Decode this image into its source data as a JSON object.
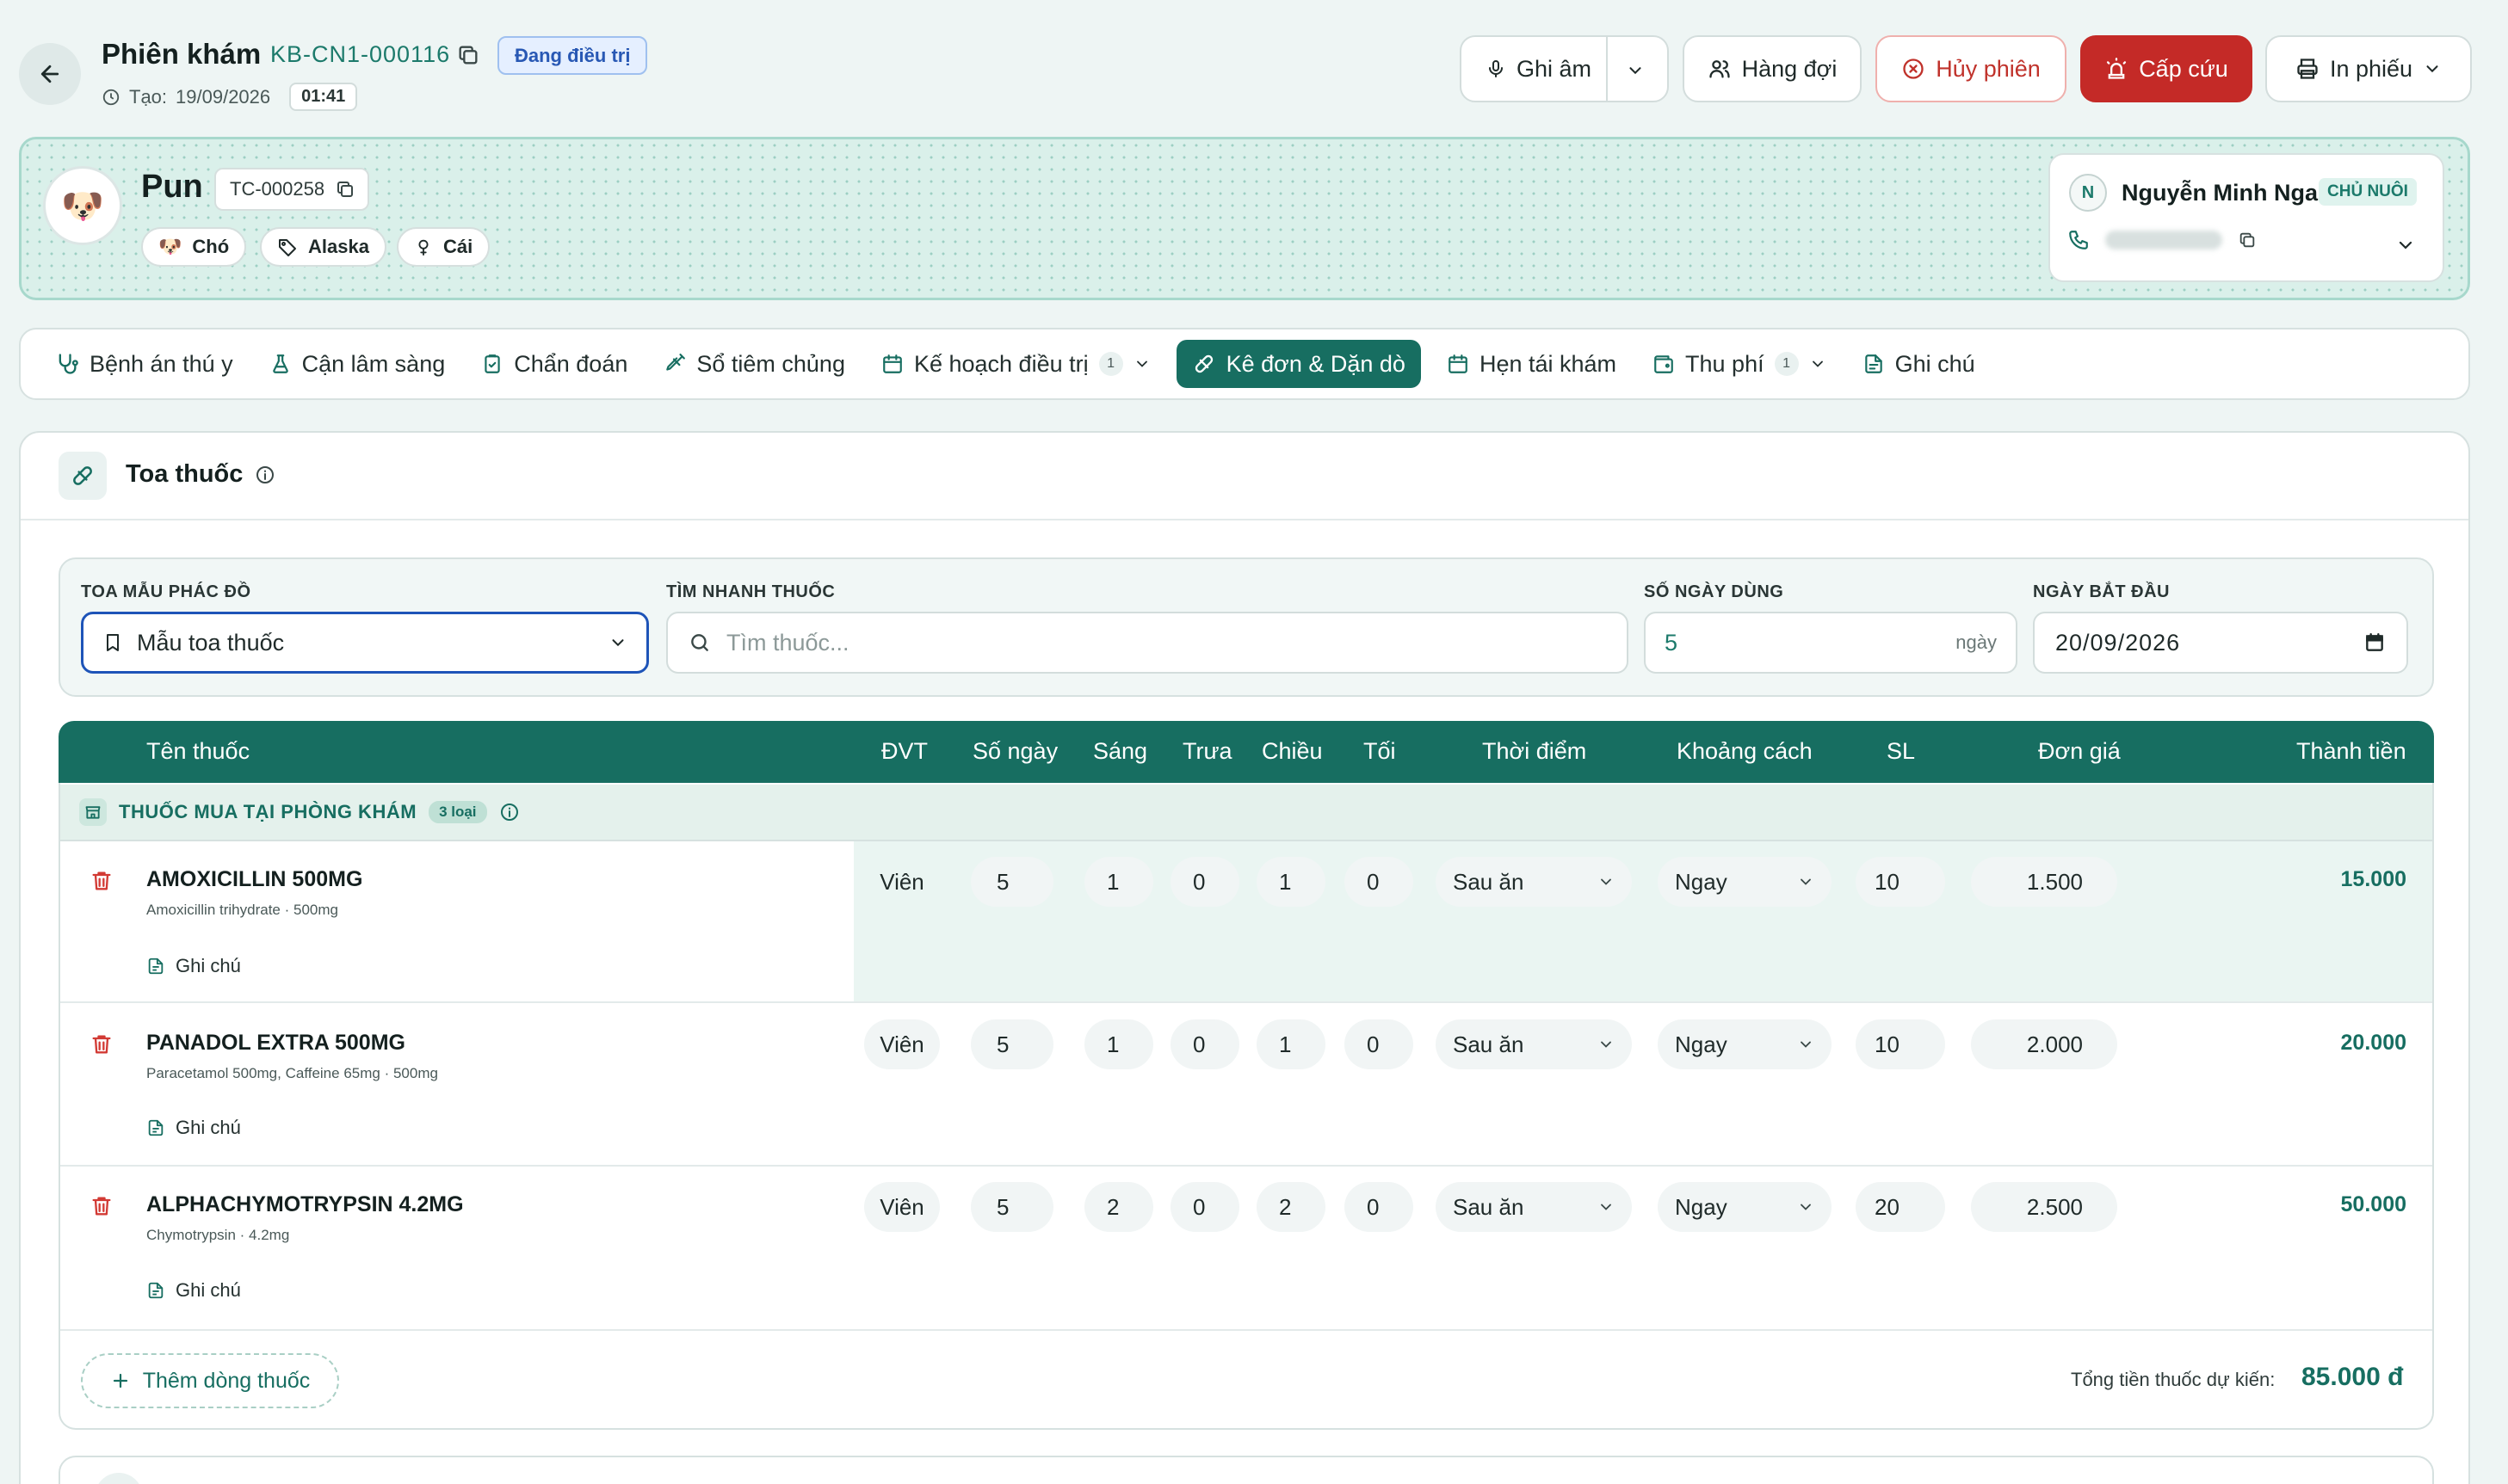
{
  "header": {
    "title": "Phiên khám",
    "code": "KB-CN1-000116",
    "status": "Đang điều trị",
    "created_label": "Tạo:",
    "created_date": "19/09/2026",
    "created_time": "01:41",
    "buttons": {
      "record": "Ghi âm",
      "queue": "Hàng đợi",
      "cancel": "Hủy phiên",
      "emergency": "Cấp cứu",
      "print": "In phiếu"
    }
  },
  "patient": {
    "name": "Pun",
    "code": "TC-000258",
    "species": "Chó",
    "breed": "Alaska",
    "sex": "Cái",
    "owner": {
      "initial": "N",
      "name": "Nguyễn Minh Nga",
      "role": "CHỦ NUÔI"
    }
  },
  "tabs": [
    {
      "label": "Bệnh án thú y",
      "icon": "stethoscope-icon"
    },
    {
      "label": "Cận lâm sàng",
      "icon": "flask-icon"
    },
    {
      "label": "Chẩn đoán",
      "icon": "clipboard-icon"
    },
    {
      "label": "Sổ tiêm chủng",
      "icon": "syringe-icon"
    },
    {
      "label": "Kế hoạch điều trị",
      "icon": "calendar-icon",
      "count": "1"
    },
    {
      "label": "Kê đơn & Dặn dò",
      "icon": "pill-icon",
      "active": true
    },
    {
      "label": "Hẹn tái khám",
      "icon": "calendar-icon"
    },
    {
      "label": "Thu phí",
      "icon": "wallet-icon",
      "count": "1"
    },
    {
      "label": "Ghi chú",
      "icon": "note-icon"
    }
  ],
  "prescription": {
    "title": "Toa thuốc",
    "filters": {
      "template_label": "TOA MẪU PHÁC ĐỒ",
      "template_value": "Mẫu toa thuốc",
      "search_label": "TÌM NHANH THUỐC",
      "search_placeholder": "Tìm thuốc...",
      "days_label": "SỐ NGÀY DÙNG",
      "days_value": "5",
      "days_suffix": "ngày",
      "start_label": "NGÀY BẮT ĐẦU",
      "start_value": "20/09/2026"
    },
    "columns": {
      "name": "Tên thuốc",
      "unit": "ĐVT",
      "days": "Số ngày",
      "morning": "Sáng",
      "noon": "Trưa",
      "afternoon": "Chiều",
      "night": "Tối",
      "timing": "Thời điểm",
      "interval": "Khoảng cách",
      "qty": "SL",
      "price": "Đơn giá",
      "total": "Thành tiền"
    },
    "group": {
      "label": "THUỐC MUA TẠI PHÒNG KHÁM",
      "count": "3 loại"
    },
    "rows": [
      {
        "name": "AMOXICILLIN 500MG",
        "sub": "Amoxicillin trihydrate · 500mg",
        "note": "Ghi chú",
        "unit": "Viên",
        "days": "5",
        "morning": "1",
        "noon": "0",
        "afternoon": "1",
        "night": "0",
        "timing": "Sau ăn",
        "interval": "Ngay",
        "qty": "10",
        "price": "1.500",
        "total": "15.000"
      },
      {
        "name": "PANADOL EXTRA 500MG",
        "sub": "Paracetamol 500mg, Caffeine 65mg · 500mg",
        "note": "Ghi chú",
        "unit": "Viên",
        "days": "5",
        "morning": "1",
        "noon": "0",
        "afternoon": "1",
        "night": "0",
        "timing": "Sau ăn",
        "interval": "Ngay",
        "qty": "10",
        "price": "2.000",
        "total": "20.000"
      },
      {
        "name": "ALPHACHYMOTRYPSIN 4.2MG",
        "sub": "Chymotrypsin · 4.2mg",
        "note": "Ghi chú",
        "unit": "Viên",
        "days": "5",
        "morning": "2",
        "noon": "0",
        "afternoon": "2",
        "night": "0",
        "timing": "Sau ăn",
        "interval": "Ngay",
        "qty": "20",
        "price": "2.500",
        "total": "50.000"
      }
    ],
    "add_row": "Thêm dòng thuốc",
    "total_label": "Tổng tiền thuốc dự kiến:",
    "total_value": "85.000 đ"
  },
  "colors": {
    "primary": "#176e61",
    "emergency": "#c42a27",
    "status_blue": "#2858b4"
  }
}
